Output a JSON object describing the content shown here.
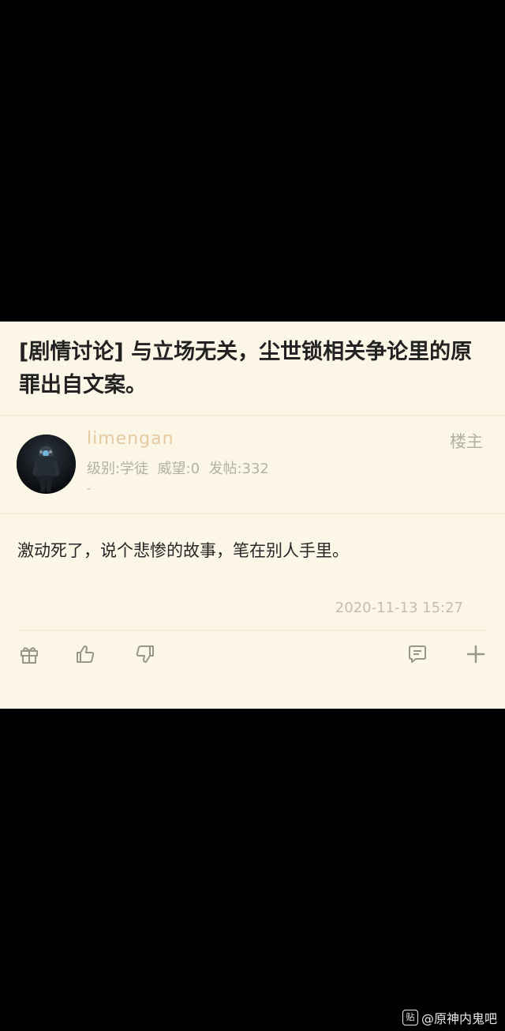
{
  "post": {
    "title": "[剧情讨论] 与立场无关，尘世锁相关争论里的原罪出自文案。",
    "author": {
      "username": "limengan",
      "badge": "楼主",
      "meta": "级别:学徒  威望:0  发帖:332",
      "extra": "-"
    },
    "content": "激动死了，说个悲惨的故事，笔在别人手里。",
    "timestamp": "2020-11-13 15:27"
  },
  "actions": [
    {
      "name": "gift-icon"
    },
    {
      "name": "thumbs-up-icon"
    },
    {
      "name": "thumbs-down-icon"
    },
    {
      "name": "comment-icon"
    },
    {
      "name": "plus-icon"
    }
  ],
  "watermark": {
    "logo": "贴",
    "text": "@原神内鬼吧"
  },
  "colors": {
    "card_bg": "#fbf6e6",
    "username": "#e6c9a0",
    "muted": "#b5b0a6"
  }
}
